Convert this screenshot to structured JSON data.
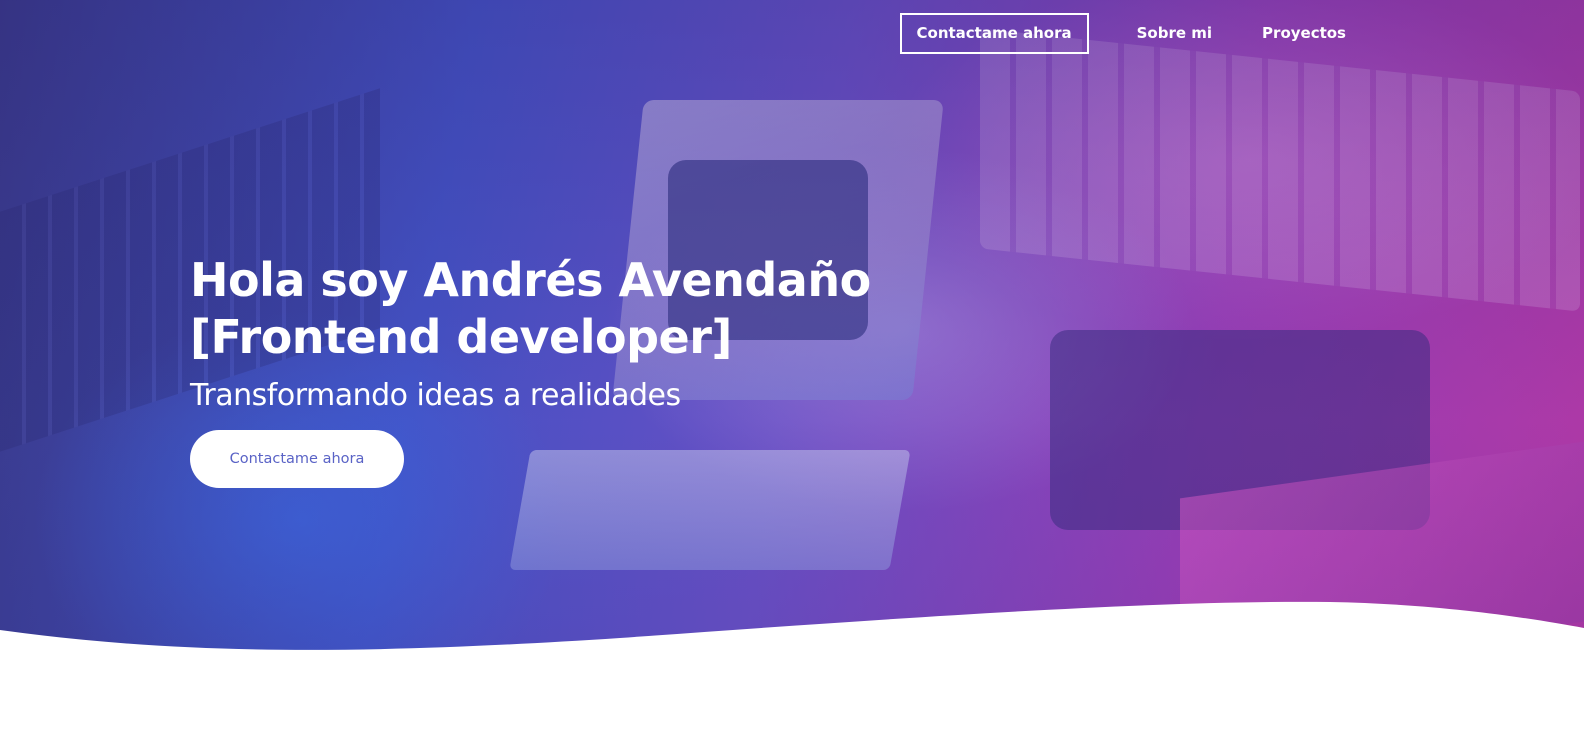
{
  "nav": {
    "items": [
      {
        "label": "Contactame ahora",
        "style": "outlined"
      },
      {
        "label": "Sobre mi",
        "style": "plain"
      },
      {
        "label": "Proyectos",
        "style": "plain"
      }
    ]
  },
  "hero": {
    "title": "Hola soy Andrés Avendaño [Frontend developer]",
    "subtitle": "Transformando ideas a realidades",
    "cta_label": "Contactame ahora"
  },
  "colors": {
    "hero_gradient_start": "#3a3a8a",
    "hero_gradient_mid": "#6b52c9",
    "hero_gradient_end": "#b73aa8",
    "cta_text": "#5a63c6",
    "nav_text": "#ffffff",
    "page_background": "#ffffff"
  }
}
